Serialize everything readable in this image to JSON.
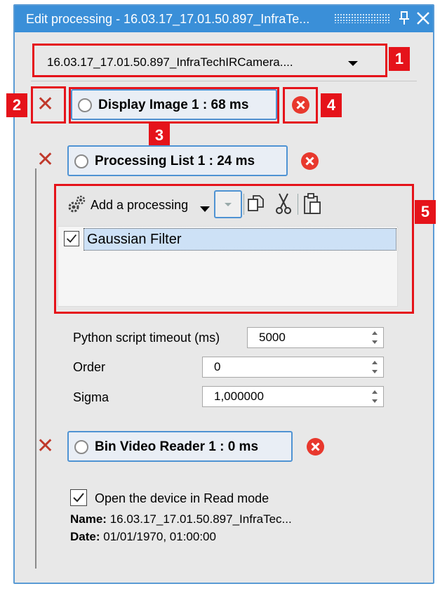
{
  "window": {
    "title": "Edit processing - 16.03.17_17.01.50.897_InfraTe...",
    "pin_icon": "pin-icon",
    "close_icon": "close-icon"
  },
  "device_selector": {
    "value": "16.03.17_17.01.50.897_InfraTechIRCamera...."
  },
  "processings": [
    {
      "label": "Display Image 1 : 68 ms"
    },
    {
      "label": "Processing List 1 : 24 ms"
    },
    {
      "label": "Bin Video Reader 1 : 0 ms"
    }
  ],
  "processing_list": {
    "add_label": "Add a processing",
    "items": [
      {
        "label": "Gaussian Filter",
        "checked": true
      }
    ],
    "properties": [
      {
        "label": "Python script timeout (ms)",
        "value": "5000"
      },
      {
        "label": "Order",
        "value": "0"
      },
      {
        "label": "Sigma",
        "value": "1,000000"
      }
    ]
  },
  "bin_video_reader": {
    "read_mode_label": "Open the device in Read mode",
    "read_mode_checked": true,
    "name_key": "Name:",
    "name_value": "16.03.17_17.01.50.897_InfraTec...",
    "date_key": "Date:",
    "date_value": "01/01/1970, 01:00:00"
  },
  "annotations": {
    "one": "1",
    "two": "2",
    "three": "3",
    "four": "4",
    "five": "5"
  },
  "colors": {
    "titlebar": "#3a8fd8",
    "annotation_red": "#e5131a",
    "pill_border": "#4f93d3",
    "selection": "#cde1f6",
    "delete_x": "#c0392b",
    "remove_circle": "#e8382d"
  }
}
